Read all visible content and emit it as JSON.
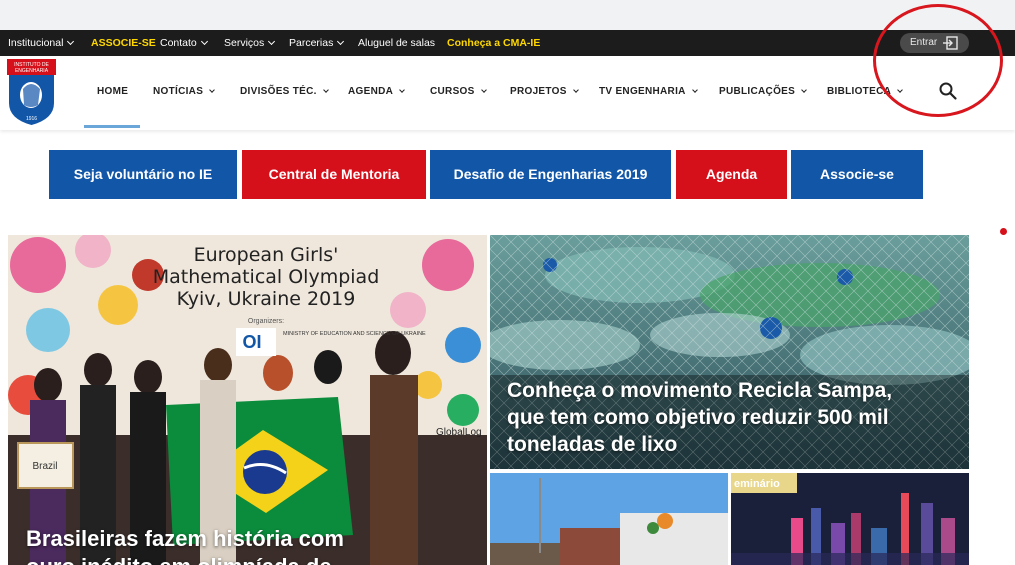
{
  "topbar": {
    "items": [
      {
        "label": "Institucional",
        "dropdown": true
      },
      {
        "label": "ASSOCIE-SE",
        "highlight": true
      },
      {
        "label": "Contato",
        "dropdown": true
      },
      {
        "label": "Serviços",
        "dropdown": true
      },
      {
        "label": "Parcerias",
        "dropdown": true
      },
      {
        "label": "Aluguel de salas"
      },
      {
        "label": "Conheça a CMA-IE",
        "highlight": true
      }
    ],
    "login_label": "Entrar"
  },
  "logo": {
    "text_top": "INSTITUTO DE ENGENHARIA",
    "year": "1916"
  },
  "nav": {
    "items": [
      {
        "label": "HOME",
        "active": true
      },
      {
        "label": "NOTÍCIAS",
        "dropdown": true
      },
      {
        "label": "DIVISÕES TÉC.",
        "dropdown": true
      },
      {
        "label": "AGENDA",
        "dropdown": true
      },
      {
        "label": "CURSOS",
        "dropdown": true
      },
      {
        "label": "PROJETOS",
        "dropdown": true
      },
      {
        "label": "TV ENGENHARIA",
        "dropdown": true
      },
      {
        "label": "PUBLICAÇÕES",
        "dropdown": true
      },
      {
        "label": "BIBLIOTECA",
        "dropdown": true
      }
    ]
  },
  "cta": [
    {
      "label": "Seja voluntário no IE",
      "color": "#1256a8"
    },
    {
      "label": "Central de Mentoria",
      "color": "#d5101b"
    },
    {
      "label": "Desafio de Engenharias 2019",
      "color": "#1256a8"
    },
    {
      "label": "Agenda",
      "color": "#d5101b"
    },
    {
      "label": "Associe-se",
      "color": "#1256a8"
    }
  ],
  "news": {
    "main": {
      "banner_line1": "European Girls'",
      "banner_line2": "Mathematical Olympiad",
      "banner_line3": "Kyiv, Ukraine 2019",
      "organizers": "Organizers:",
      "ministry": "MINISTRY OF EDUCATION AND SCIENCE OF UKRAINE",
      "sign_text": "Brazil",
      "globallogic": "GlobalLog",
      "headline_line1": "Brasileiras fazem história com",
      "headline_line2": "ouro inédito em olimpíada de"
    },
    "top_right": {
      "headline_line1": "Conheça o movimento Recicla Sampa,",
      "headline_line2": "que tem como objetivo reduzir 500 mil",
      "headline_line3": "toneladas de lixo"
    },
    "bottom_right_2": {
      "tag": "eminário"
    }
  },
  "colors": {
    "brand_blue": "#1256a8",
    "brand_red": "#d5101b",
    "highlight_yellow": "#ffd800",
    "topbar_bg": "#1c1c1c"
  }
}
